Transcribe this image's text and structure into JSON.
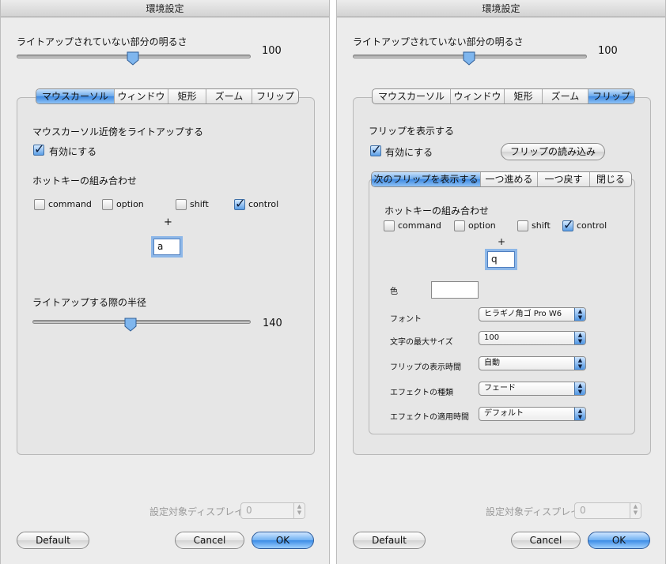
{
  "left": {
    "title": "環境設定",
    "brightness": {
      "label": "ライトアップされていない部分の明るさ",
      "value": "100",
      "slider_fraction": 0.5
    },
    "tabs": [
      {
        "label": "マウスカーソル",
        "selected": true
      },
      {
        "label": "ウィンドウ",
        "selected": false
      },
      {
        "label": "矩形",
        "selected": false
      },
      {
        "label": "ズーム",
        "selected": false
      },
      {
        "label": "フリップ",
        "selected": false
      }
    ],
    "section_title": "マウスカーソル近傍をライトアップする",
    "enable_label": "有効にする",
    "hotkey_title": "ホットキーの組み合わせ",
    "modifiers": {
      "command": "command",
      "option": "option",
      "shift": "shift",
      "control": "control"
    },
    "plus": "+",
    "key_value": "a",
    "radius": {
      "label": "ライトアップする際の半径",
      "value": "140",
      "slider_fraction": 0.45
    },
    "display": {
      "label": "設定対象ディスプレイ",
      "value": "0"
    },
    "buttons": {
      "default": "Default",
      "cancel": "Cancel",
      "ok": "OK"
    }
  },
  "right": {
    "title": "環境設定",
    "brightness": {
      "label": "ライトアップされていない部分の明るさ",
      "value": "100",
      "slider_fraction": 0.5
    },
    "tabs": [
      {
        "label": "マウスカーソル",
        "selected": false
      },
      {
        "label": "ウィンドウ",
        "selected": false
      },
      {
        "label": "矩形",
        "selected": false
      },
      {
        "label": "ズーム",
        "selected": false
      },
      {
        "label": "フリップ",
        "selected": true
      }
    ],
    "section_title": "フリップを表示する",
    "enable_label": "有効にする",
    "load_button": "フリップの読み込み",
    "subtabs": [
      {
        "label": "次のフリップを表示する",
        "selected": true
      },
      {
        "label": "一つ進める",
        "selected": false
      },
      {
        "label": "一つ戻す",
        "selected": false
      },
      {
        "label": "閉じる",
        "selected": false
      }
    ],
    "hotkey_title": "ホットキーの組み合わせ",
    "modifiers": {
      "command": "command",
      "option": "option",
      "shift": "shift",
      "control": "control"
    },
    "plus": "+",
    "key_value": "q",
    "color_label": "色",
    "font_label": "フォント",
    "font_value": "ヒラギノ角ゴ Pro W6",
    "max_size_label": "文字の最大サイズ",
    "max_size_value": "100",
    "display_time_label": "フリップの表示時間",
    "display_time_value": "自動",
    "effect_type_label": "エフェクトの種類",
    "effect_type_value": "フェード",
    "effect_time_label": "エフェクトの適用時間",
    "effect_time_value": "デフォルト",
    "display": {
      "label": "設定対象ディスプレイ",
      "value": "0"
    },
    "buttons": {
      "default": "Default",
      "cancel": "Cancel",
      "ok": "OK"
    }
  }
}
